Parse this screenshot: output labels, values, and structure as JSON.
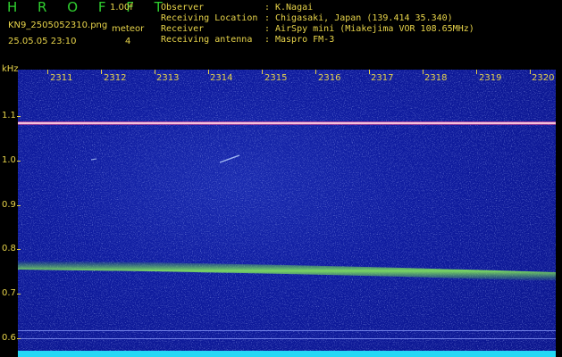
{
  "header": {
    "brand": "H R O F F T",
    "version": "1.00f",
    "filename": "KN9_2505052310.png",
    "datetime": "25.05.05 23:10",
    "event_label": "meteor",
    "event_count": "4",
    "rows": [
      {
        "key": "Observer",
        "value": "K.Nagai"
      },
      {
        "key": "Receiving Location",
        "value": "Chigasaki, Japan (139.414 35.340)"
      },
      {
        "key": "Receiver",
        "value": "AirSpy mini (Miakejima VOR 108.65MHz)"
      },
      {
        "key": "Receiving antenna",
        "value": "Maspro FM-3"
      }
    ],
    "separator": ":"
  },
  "plot": {
    "y_unit": "kHz",
    "y_ticks": [
      "1.1",
      "1.0",
      "0.9",
      "0.8",
      "0.7",
      "0.6"
    ],
    "x_ticks": [
      "2311",
      "2312",
      "2313",
      "2314",
      "2315",
      "2316",
      "2317",
      "2318",
      "2319",
      "2320"
    ]
  },
  "colors": {
    "label": "#e8d44a",
    "brand": "#2fcf2f",
    "background": "#0f1ca0",
    "baseline": "#25d8f5",
    "carrier": "#ff5aa0",
    "band": "#5fcf4a"
  }
}
